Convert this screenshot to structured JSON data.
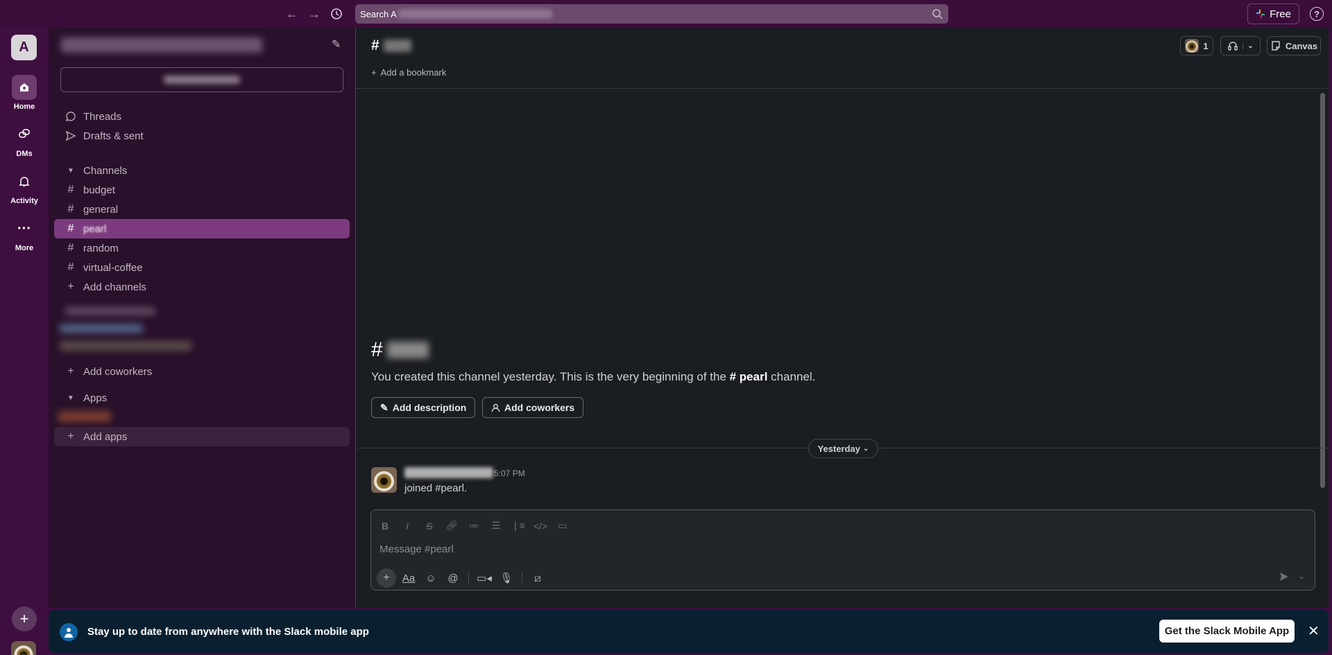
{
  "topbar": {
    "search_prefix": "Search A",
    "free_label": "Free"
  },
  "rail": {
    "workspace_initial": "A",
    "items": [
      {
        "label": "Home"
      },
      {
        "label": "DMs"
      },
      {
        "label": "Activity"
      },
      {
        "label": "More"
      }
    ]
  },
  "sidebar": {
    "threads": "Threads",
    "drafts": "Drafts & sent",
    "channels_header": "Channels",
    "channels": [
      "budget",
      "general",
      "pearl",
      "random",
      "virtual-coffee"
    ],
    "add_channels": "Add channels",
    "add_coworkers": "Add coworkers",
    "apps_header": "Apps",
    "add_apps": "Add apps"
  },
  "channel": {
    "hash": "#",
    "add_bookmark": "Add a bookmark",
    "member_count": "1",
    "canvas_label": "Canvas",
    "intro_text_prefix": "You created this channel yesterday. This is the very beginning of the ",
    "intro_channel": "# pearl",
    "intro_text_suffix": " channel.",
    "add_description": "Add description",
    "add_coworkers": "Add coworkers",
    "day_divider": "Yesterday",
    "message": {
      "time": "5:07 PM",
      "text": "joined #pearl."
    },
    "composer_placeholder": "Message #pearl"
  },
  "banner": {
    "text": "Stay up to date from anywhere with the Slack mobile app",
    "button": "Get the Slack Mobile App"
  }
}
